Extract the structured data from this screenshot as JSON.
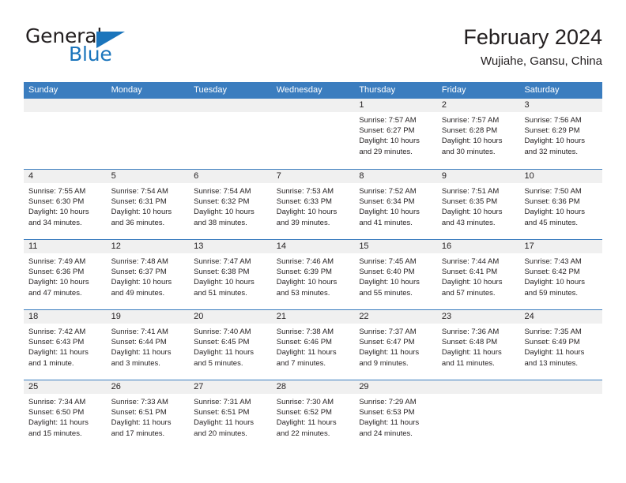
{
  "logo": {
    "text_primary": "General",
    "text_secondary": "Blue",
    "triangle_icon": "triangle-icon",
    "brand_color": "#1b75bc"
  },
  "header": {
    "title": "February 2024",
    "subtitle": "Wujiahe, Gansu, China"
  },
  "calendar": {
    "header_color": "#3b7dbf",
    "day_band_color": "#f0f0f0",
    "weekday_headers": [
      "Sunday",
      "Monday",
      "Tuesday",
      "Wednesday",
      "Thursday",
      "Friday",
      "Saturday"
    ],
    "weeks": [
      [
        {
          "day": "",
          "lines": []
        },
        {
          "day": "",
          "lines": []
        },
        {
          "day": "",
          "lines": []
        },
        {
          "day": "",
          "lines": []
        },
        {
          "day": "1",
          "lines": [
            "Sunrise: 7:57 AM",
            "Sunset: 6:27 PM",
            "Daylight: 10 hours and 29 minutes."
          ]
        },
        {
          "day": "2",
          "lines": [
            "Sunrise: 7:57 AM",
            "Sunset: 6:28 PM",
            "Daylight: 10 hours and 30 minutes."
          ]
        },
        {
          "day": "3",
          "lines": [
            "Sunrise: 7:56 AM",
            "Sunset: 6:29 PM",
            "Daylight: 10 hours and 32 minutes."
          ]
        }
      ],
      [
        {
          "day": "4",
          "lines": [
            "Sunrise: 7:55 AM",
            "Sunset: 6:30 PM",
            "Daylight: 10 hours and 34 minutes."
          ]
        },
        {
          "day": "5",
          "lines": [
            "Sunrise: 7:54 AM",
            "Sunset: 6:31 PM",
            "Daylight: 10 hours and 36 minutes."
          ]
        },
        {
          "day": "6",
          "lines": [
            "Sunrise: 7:54 AM",
            "Sunset: 6:32 PM",
            "Daylight: 10 hours and 38 minutes."
          ]
        },
        {
          "day": "7",
          "lines": [
            "Sunrise: 7:53 AM",
            "Sunset: 6:33 PM",
            "Daylight: 10 hours and 39 minutes."
          ]
        },
        {
          "day": "8",
          "lines": [
            "Sunrise: 7:52 AM",
            "Sunset: 6:34 PM",
            "Daylight: 10 hours and 41 minutes."
          ]
        },
        {
          "day": "9",
          "lines": [
            "Sunrise: 7:51 AM",
            "Sunset: 6:35 PM",
            "Daylight: 10 hours and 43 minutes."
          ]
        },
        {
          "day": "10",
          "lines": [
            "Sunrise: 7:50 AM",
            "Sunset: 6:36 PM",
            "Daylight: 10 hours and 45 minutes."
          ]
        }
      ],
      [
        {
          "day": "11",
          "lines": [
            "Sunrise: 7:49 AM",
            "Sunset: 6:36 PM",
            "Daylight: 10 hours and 47 minutes."
          ]
        },
        {
          "day": "12",
          "lines": [
            "Sunrise: 7:48 AM",
            "Sunset: 6:37 PM",
            "Daylight: 10 hours and 49 minutes."
          ]
        },
        {
          "day": "13",
          "lines": [
            "Sunrise: 7:47 AM",
            "Sunset: 6:38 PM",
            "Daylight: 10 hours and 51 minutes."
          ]
        },
        {
          "day": "14",
          "lines": [
            "Sunrise: 7:46 AM",
            "Sunset: 6:39 PM",
            "Daylight: 10 hours and 53 minutes."
          ]
        },
        {
          "day": "15",
          "lines": [
            "Sunrise: 7:45 AM",
            "Sunset: 6:40 PM",
            "Daylight: 10 hours and 55 minutes."
          ]
        },
        {
          "day": "16",
          "lines": [
            "Sunrise: 7:44 AM",
            "Sunset: 6:41 PM",
            "Daylight: 10 hours and 57 minutes."
          ]
        },
        {
          "day": "17",
          "lines": [
            "Sunrise: 7:43 AM",
            "Sunset: 6:42 PM",
            "Daylight: 10 hours and 59 minutes."
          ]
        }
      ],
      [
        {
          "day": "18",
          "lines": [
            "Sunrise: 7:42 AM",
            "Sunset: 6:43 PM",
            "Daylight: 11 hours and 1 minute."
          ]
        },
        {
          "day": "19",
          "lines": [
            "Sunrise: 7:41 AM",
            "Sunset: 6:44 PM",
            "Daylight: 11 hours and 3 minutes."
          ]
        },
        {
          "day": "20",
          "lines": [
            "Sunrise: 7:40 AM",
            "Sunset: 6:45 PM",
            "Daylight: 11 hours and 5 minutes."
          ]
        },
        {
          "day": "21",
          "lines": [
            "Sunrise: 7:38 AM",
            "Sunset: 6:46 PM",
            "Daylight: 11 hours and 7 minutes."
          ]
        },
        {
          "day": "22",
          "lines": [
            "Sunrise: 7:37 AM",
            "Sunset: 6:47 PM",
            "Daylight: 11 hours and 9 minutes."
          ]
        },
        {
          "day": "23",
          "lines": [
            "Sunrise: 7:36 AM",
            "Sunset: 6:48 PM",
            "Daylight: 11 hours and 11 minutes."
          ]
        },
        {
          "day": "24",
          "lines": [
            "Sunrise: 7:35 AM",
            "Sunset: 6:49 PM",
            "Daylight: 11 hours and 13 minutes."
          ]
        }
      ],
      [
        {
          "day": "25",
          "lines": [
            "Sunrise: 7:34 AM",
            "Sunset: 6:50 PM",
            "Daylight: 11 hours and 15 minutes."
          ]
        },
        {
          "day": "26",
          "lines": [
            "Sunrise: 7:33 AM",
            "Sunset: 6:51 PM",
            "Daylight: 11 hours and 17 minutes."
          ]
        },
        {
          "day": "27",
          "lines": [
            "Sunrise: 7:31 AM",
            "Sunset: 6:51 PM",
            "Daylight: 11 hours and 20 minutes."
          ]
        },
        {
          "day": "28",
          "lines": [
            "Sunrise: 7:30 AM",
            "Sunset: 6:52 PM",
            "Daylight: 11 hours and 22 minutes."
          ]
        },
        {
          "day": "29",
          "lines": [
            "Sunrise: 7:29 AM",
            "Sunset: 6:53 PM",
            "Daylight: 11 hours and 24 minutes."
          ]
        },
        {
          "day": "",
          "lines": []
        },
        {
          "day": "",
          "lines": []
        }
      ]
    ]
  }
}
